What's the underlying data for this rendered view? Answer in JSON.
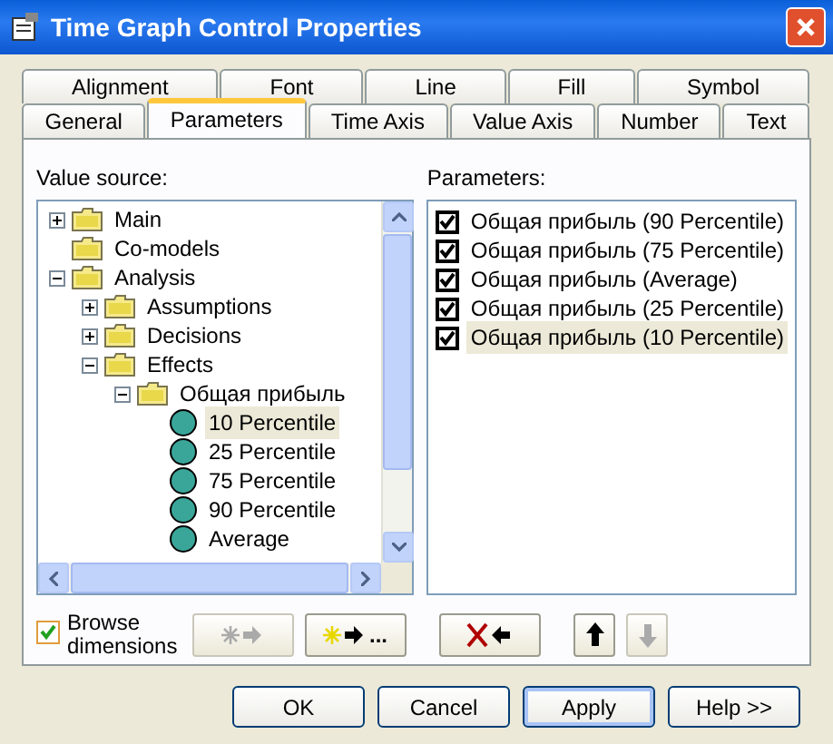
{
  "window": {
    "title": "Time Graph Control Properties"
  },
  "tab_rows": [
    [
      {
        "label": "Alignment",
        "selected": false
      },
      {
        "label": "Font",
        "selected": false
      },
      {
        "label": "Line",
        "selected": false
      },
      {
        "label": "Fill",
        "selected": false
      },
      {
        "label": "Symbol",
        "selected": false
      }
    ],
    [
      {
        "label": "General",
        "selected": false
      },
      {
        "label": "Parameters",
        "selected": true
      },
      {
        "label": "Time Axis",
        "selected": false
      },
      {
        "label": "Value Axis",
        "selected": false
      },
      {
        "label": "Number",
        "selected": false
      },
      {
        "label": "Text",
        "selected": false
      }
    ]
  ],
  "value_source": {
    "label": "Value source:",
    "tree": [
      {
        "label": "Main",
        "kind": "folder",
        "expanded": false,
        "selected": false
      },
      {
        "label": "Co-models",
        "kind": "folder",
        "selected": false
      },
      {
        "label": "Analysis",
        "kind": "folder",
        "expanded": true,
        "selected": false,
        "children": [
          {
            "label": "Assumptions",
            "kind": "folder",
            "expanded": false,
            "selected": false
          },
          {
            "label": "Decisions",
            "kind": "folder",
            "expanded": false,
            "selected": false
          },
          {
            "label": "Effects",
            "kind": "folder",
            "expanded": true,
            "selected": false,
            "children": [
              {
                "label": "Общая прибыль",
                "kind": "folder",
                "expanded": true,
                "selected": false,
                "children": [
                  {
                    "label": "10 Percentile",
                    "kind": "value",
                    "selected": true
                  },
                  {
                    "label": "25 Percentile",
                    "kind": "value",
                    "selected": false
                  },
                  {
                    "label": "75 Percentile",
                    "kind": "value",
                    "selected": false
                  },
                  {
                    "label": "90 Percentile",
                    "kind": "value",
                    "selected": false
                  },
                  {
                    "label": "Average",
                    "kind": "value",
                    "selected": false
                  }
                ]
              }
            ]
          }
        ]
      }
    ]
  },
  "parameters": {
    "label": "Parameters:",
    "items": [
      {
        "label": "Общая прибыль (90 Percentile)",
        "checked": true,
        "selected": false
      },
      {
        "label": "Общая прибыль (75 Percentile)",
        "checked": true,
        "selected": false
      },
      {
        "label": "Общая прибыль (Average)",
        "checked": true,
        "selected": false
      },
      {
        "label": "Общая прибыль (25 Percentile)",
        "checked": true,
        "selected": false
      },
      {
        "label": "Общая прибыль (10 Percentile)",
        "checked": true,
        "selected": true
      }
    ]
  },
  "browse_dimensions": {
    "label": "Browse dimensions",
    "checked": true
  },
  "tool_buttons": [
    {
      "kind": "add",
      "disabled": true
    },
    {
      "kind": "add_more",
      "label": "...",
      "disabled": false
    },
    {
      "kind": "remove",
      "disabled": false
    },
    {
      "kind": "up",
      "disabled": false
    },
    {
      "kind": "down",
      "disabled": true
    }
  ],
  "dialog_buttons": [
    {
      "label": "OK",
      "focused": false
    },
    {
      "label": "Cancel",
      "focused": false
    },
    {
      "label": "Apply",
      "focused": true
    },
    {
      "label": "Help >>",
      "focused": false
    }
  ]
}
